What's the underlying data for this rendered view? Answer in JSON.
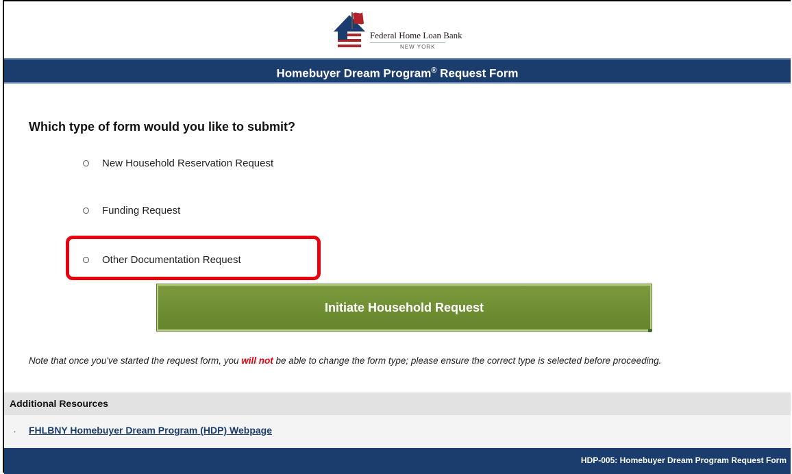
{
  "header": {
    "logo_line1": "Federal Home Loan Bank",
    "logo_line2": "NEW YORK",
    "title": "Homebuyer Dream Program",
    "title_mark": "®",
    "title_suffix": " Request Form"
  },
  "form": {
    "question": "Which type of form would you like to submit?",
    "options": [
      {
        "label": "New Household Reservation Request",
        "selected": false
      },
      {
        "label": "Funding Request",
        "selected": false
      },
      {
        "label": "Other Documentation Request",
        "selected": false
      }
    ],
    "highlighted_option": "Other Documentation Request",
    "submit_label": "Initiate Household Request"
  },
  "note": {
    "before": "Note that once you've started the request form, you ",
    "warning": "will not",
    "after": "  be able to change the form type; please ensure the correct type is selected before proceeding."
  },
  "resources": {
    "header": "Additional Resources",
    "links": [
      {
        "label": "FHLBNY Homebuyer Dream Program (HDP) Webpage"
      }
    ]
  },
  "footer": {
    "text": "HDP-005: Homebuyer Dream Program Request Form"
  },
  "colors": {
    "navy": "#1b3d6d",
    "button_green": "#6e8d33",
    "highlight_red": "#e8000d"
  },
  "icons": {
    "logo": "house-flag-logo",
    "radio": "radio-button-unselected",
    "bullet": "bullet-dot"
  }
}
